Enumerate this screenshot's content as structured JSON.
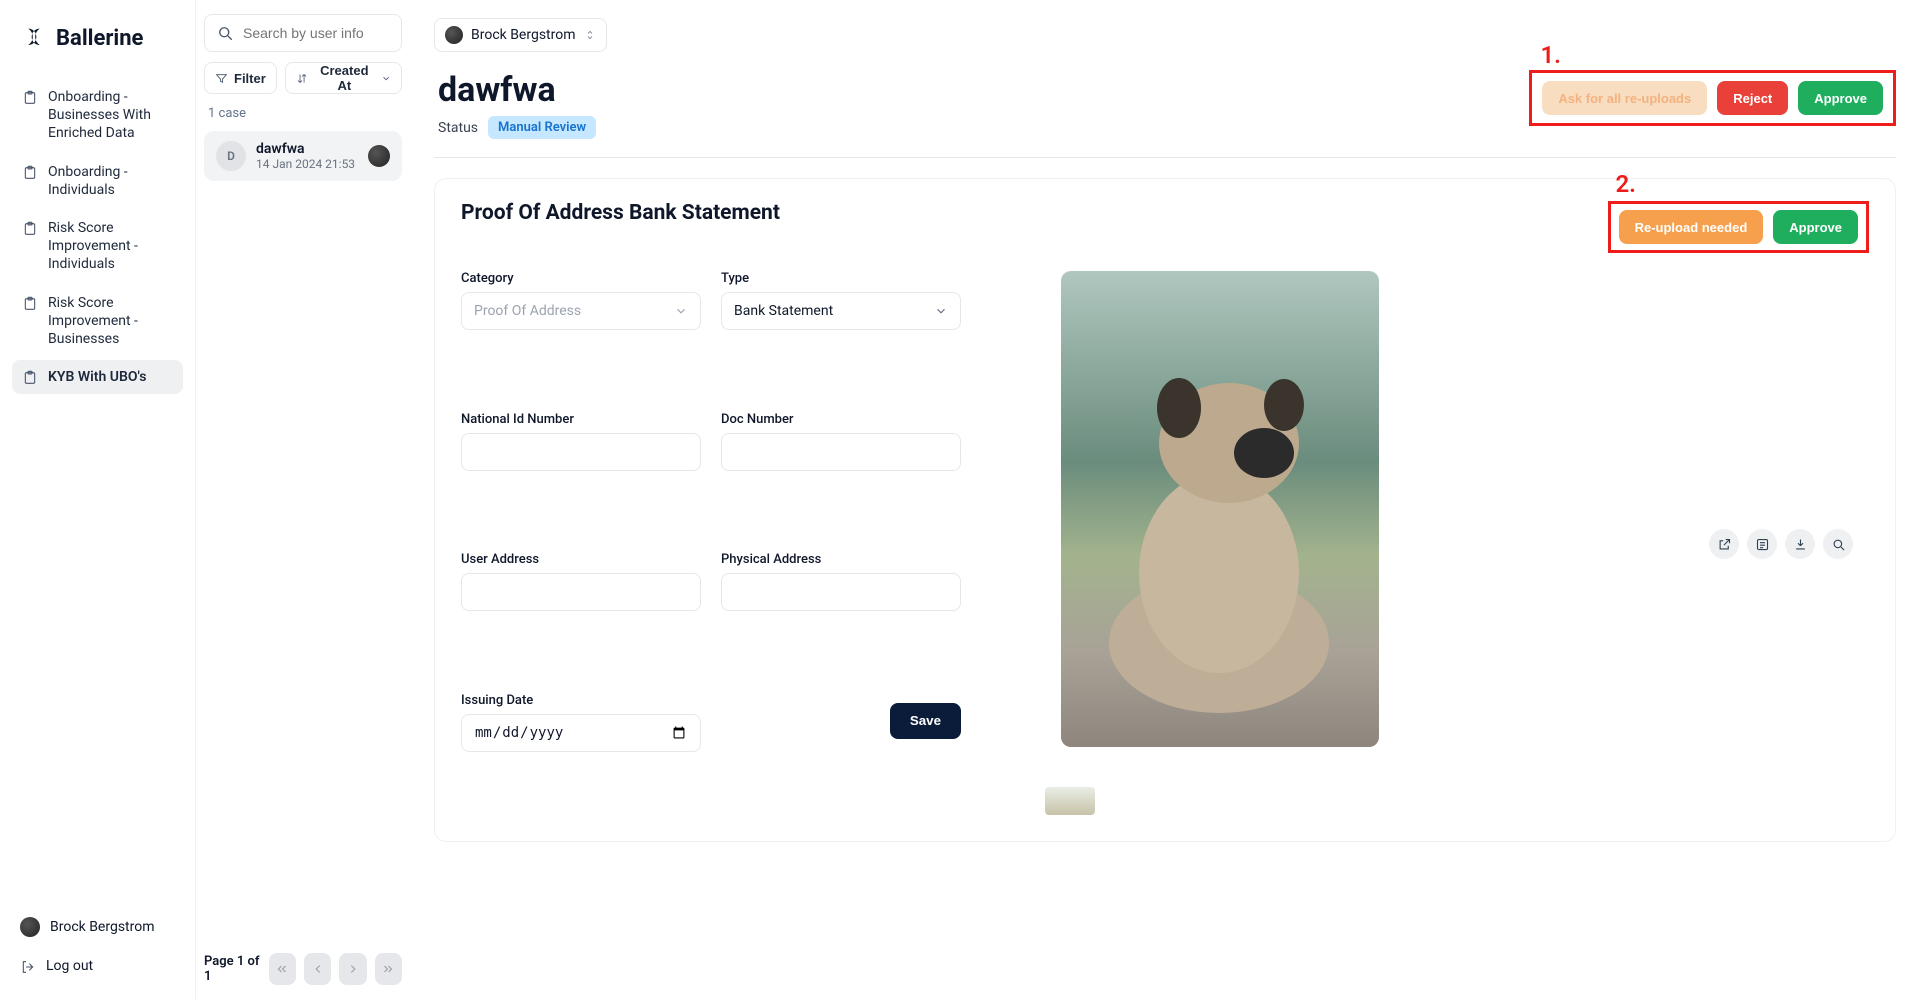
{
  "brand": "Ballerine",
  "sidebar": {
    "items": [
      {
        "label": "Onboarding - Businesses With Enriched Data"
      },
      {
        "label": "Onboarding - Individuals"
      },
      {
        "label": "Risk Score Improvement - Individuals"
      },
      {
        "label": "Risk Score Improvement - Businesses"
      },
      {
        "label": "KYB With UBO's"
      }
    ],
    "active_index": 4,
    "user": "Brock Bergstrom",
    "logout_label": "Log out"
  },
  "midcol": {
    "search_placeholder": "Search by user info",
    "filter_label": "Filter",
    "sort_label": "Created At",
    "case_count": "1 case",
    "cases": [
      {
        "initial": "D",
        "name": "dawfwa",
        "date": "14 Jan 2024 21:53"
      }
    ],
    "pagination": "Page 1 of 1"
  },
  "main": {
    "selector_user": "Brock Bergstrom",
    "title": "dawfwa",
    "status_label": "Status",
    "status_badge": "Manual Review",
    "actions": {
      "ask_all": "Ask for all re-uploads",
      "reject": "Reject",
      "approve": "Approve"
    },
    "annotations": {
      "one": "1.",
      "two": "2."
    },
    "doc": {
      "title": "Proof Of Address Bank Statement",
      "actions": {
        "reupload": "Re-upload needed",
        "approve": "Approve"
      },
      "fields": {
        "category": {
          "label": "Category",
          "value": "Proof Of Address"
        },
        "type": {
          "label": "Type",
          "value": "Bank Statement"
        },
        "national_id": {
          "label": "National Id Number",
          "value": ""
        },
        "doc_number": {
          "label": "Doc Number",
          "value": ""
        },
        "user_address": {
          "label": "User Address",
          "value": ""
        },
        "physical_address": {
          "label": "Physical Address",
          "value": ""
        },
        "issuing_date": {
          "label": "Issuing Date",
          "placeholder": "mm/dd/yyyy"
        }
      },
      "save_label": "Save"
    }
  }
}
